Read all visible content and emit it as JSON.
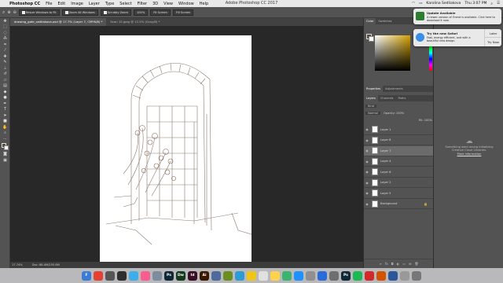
{
  "menubar": {
    "app": "Photoshop CC",
    "items": [
      "File",
      "Edit",
      "Image",
      "Layer",
      "Type",
      "Select",
      "Filter",
      "3D",
      "View",
      "Window",
      "Help"
    ],
    "window_title": "Adobe Photoshop CC 2017",
    "user": "Karolina Sedliakova",
    "clock": "Thu 3:07 PM"
  },
  "options_bar": {
    "resize_windows": "Resize Windows to Fit",
    "zoom_all": "Zoom All Windows",
    "scrubby_zoom": "Scrubby Zoom",
    "pct100": "100%",
    "fit_screen": "Fit Screen",
    "fill_screen": "Fill Screen"
  },
  "tabs": [
    {
      "label": "drawing_gate_sedliakova.psd @ 17.7% (Layer 7, CMYK/8) *"
    },
    {
      "label": "Scan 15.jpeg @ 12.5% (Gray/8) *"
    }
  ],
  "status": {
    "zoom": "17.74%",
    "doc": "Doc: 88.4M/255.8M"
  },
  "color_panel": {
    "tabs": [
      "Color",
      "Swatches"
    ],
    "accent": "#d4a100"
  },
  "prop_panel": {
    "tabs": [
      "Properties",
      "Adjustments"
    ]
  },
  "layers_panel": {
    "tabs": [
      "Layers",
      "Channels",
      "Paths"
    ],
    "kind": "Kind",
    "blend": "Normal",
    "opacity": "Opacity: 100%",
    "fill": "Fill: 100%",
    "layers": [
      {
        "name": "Layer 1",
        "selected": false
      },
      {
        "name": "Layer 8",
        "selected": false
      },
      {
        "name": "Layer 7",
        "selected": true
      },
      {
        "name": "Layer 4",
        "selected": false
      },
      {
        "name": "Layer 6",
        "selected": false
      },
      {
        "name": "Layer 2",
        "selected": false
      },
      {
        "name": "Layer 5",
        "selected": false
      },
      {
        "name": "Background",
        "selected": false
      }
    ]
  },
  "side_panel": {
    "msg": "Something went wrong initializing Creative Cloud Libraries.",
    "more": "More information"
  },
  "notifications": {
    "update_title": "Update Available",
    "update_body": "A newer version of Orend is available. Click here to download it now.",
    "safari_title": "Try the new Safari",
    "safari_body": "Fast, energy efficient, and with a beautiful new design.",
    "later": "Later",
    "try_now": "Try Now"
  },
  "dock": {
    "apps": [
      {
        "label": "F",
        "color": "#3a7bd5",
        "icon": "finder-icon"
      },
      {
        "label": "",
        "color": "#e34133",
        "icon": "chrome-icon"
      },
      {
        "label": "",
        "color": "#555555",
        "icon": "video-icon"
      },
      {
        "label": "",
        "color": "#2e2e2e",
        "icon": "final-cut-icon"
      },
      {
        "label": "",
        "color": "#3daee9",
        "icon": "safari-icon"
      },
      {
        "label": "",
        "color": "#fa5c8e",
        "icon": "itunes-icon"
      },
      {
        "label": "",
        "color": "#7b8d9e",
        "icon": "files-icon"
      },
      {
        "label": "Ps",
        "color": "#0f2838",
        "icon": "photoshop-icon"
      },
      {
        "label": "Dw",
        "color": "#15381e",
        "icon": "dreamweaver-icon"
      },
      {
        "label": "Id",
        "color": "#3a0f24",
        "icon": "indesign-icon"
      },
      {
        "label": "Ai",
        "color": "#3a1800",
        "icon": "illustrator-icon"
      },
      {
        "label": "",
        "color": "#4e6b9e",
        "icon": "photos-icon"
      },
      {
        "label": "",
        "color": "#6b8e23",
        "icon": "maps-icon"
      },
      {
        "label": "",
        "color": "#2f9bd6",
        "icon": "mail-icon"
      },
      {
        "label": "",
        "color": "#f0c419",
        "icon": "notes-icon"
      },
      {
        "label": "",
        "color": "#e0e0e0",
        "icon": "calendar-icon"
      },
      {
        "label": "",
        "color": "#ffd24d",
        "icon": "stickies-icon"
      },
      {
        "label": "",
        "color": "#3cb371",
        "icon": "messages-icon"
      },
      {
        "label": "",
        "color": "#1e90ff",
        "icon": "facetime-icon"
      },
      {
        "label": "",
        "color": "#8f8f8f",
        "icon": "contacts-icon"
      },
      {
        "label": "",
        "color": "#2a6bd9",
        "icon": "appstore-icon"
      },
      {
        "label": "",
        "color": "#6e6e6e",
        "icon": "settings-icon"
      },
      {
        "label": "Ps",
        "color": "#0f2838",
        "icon": "photoshop2-icon"
      },
      {
        "label": "",
        "color": "#1db954",
        "icon": "spotify-icon"
      },
      {
        "label": "",
        "color": "#d12a2a",
        "icon": "acrobat-icon"
      },
      {
        "label": "",
        "color": "#d35400",
        "icon": "powerpoint-icon"
      },
      {
        "label": "",
        "color": "#2b579a",
        "icon": "word-icon"
      },
      {
        "label": "",
        "color": "#999999",
        "icon": "downloads-icon"
      },
      {
        "label": "",
        "color": "#777777",
        "icon": "trash-icon"
      }
    ]
  }
}
